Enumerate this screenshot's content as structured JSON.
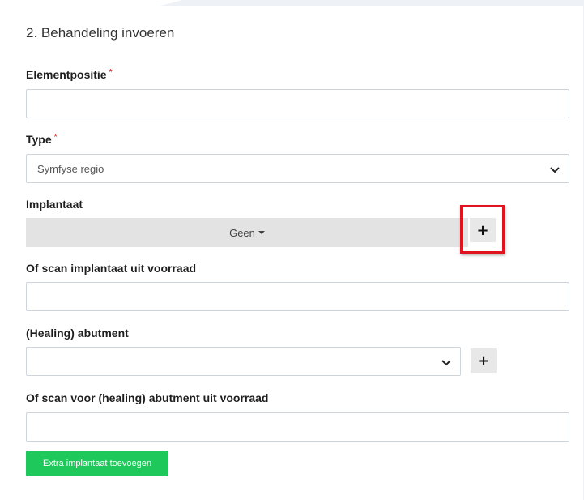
{
  "section": {
    "title": "2. Behandeling invoeren"
  },
  "fields": {
    "elementpositie": {
      "label": "Elementpositie",
      "required_mark": "*",
      "value": ""
    },
    "type": {
      "label": "Type",
      "required_mark": "*",
      "selected": "Symfyse regio"
    },
    "implantaat": {
      "label": "Implantaat",
      "dropdown_label": "Geen",
      "add_label": "+"
    },
    "scan_implantaat": {
      "label": "Of scan implantaat uit voorraad",
      "value": ""
    },
    "abutment": {
      "label": "(Healing) abutment",
      "selected": "",
      "add_label": "+"
    },
    "scan_abutment": {
      "label": "Of scan voor (healing) abutment uit voorraad",
      "value": ""
    }
  },
  "actions": {
    "add_implant_label": "Extra implantaat toevoegen"
  },
  "colors": {
    "accent_green": "#1ec85a",
    "highlight_red": "#e0141e",
    "required_red": "#e53935"
  }
}
